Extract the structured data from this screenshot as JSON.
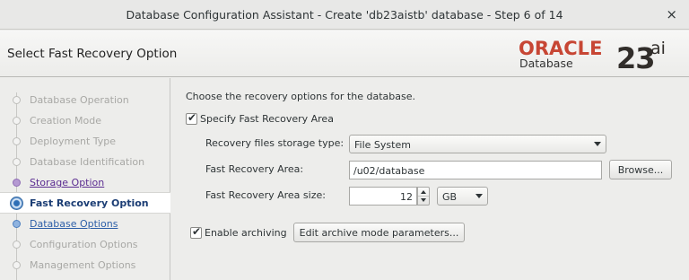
{
  "window": {
    "title": "Database Configuration Assistant - Create 'db23aistb' database - Step 6 of 14",
    "close_glyph": "×"
  },
  "header": {
    "page_title": "Select Fast Recovery Option",
    "logo": {
      "oracle": "ORACLE",
      "database": "Database",
      "version": "23",
      "suffix": "ai",
      "brand_color": "#c74634"
    }
  },
  "sidebar": {
    "steps": [
      {
        "label": "Database Operation",
        "state": "disabled"
      },
      {
        "label": "Creation Mode",
        "state": "disabled"
      },
      {
        "label": "Deployment Type",
        "state": "disabled"
      },
      {
        "label": "Database Identification",
        "state": "disabled"
      },
      {
        "label": "Storage Option",
        "state": "visited"
      },
      {
        "label": "Fast Recovery Option",
        "state": "current"
      },
      {
        "label": "Database Options",
        "state": "next"
      },
      {
        "label": "Configuration Options",
        "state": "disabled"
      },
      {
        "label": "Management Options",
        "state": "disabled"
      }
    ]
  },
  "main": {
    "intro": "Choose the recovery options for the database.",
    "specify_fra": {
      "label": "Specify Fast Recovery Area",
      "checked": true
    },
    "storage_type": {
      "label": "Recovery files storage type:",
      "value": "File System"
    },
    "fra_location": {
      "label": "Fast Recovery Area:",
      "value": "/u02/database",
      "browse_label": "Browse..."
    },
    "fra_size": {
      "label": "Fast Recovery Area size:",
      "value": "12",
      "unit": "GB"
    },
    "enable_archiving": {
      "label": "Enable archiving",
      "checked": true
    },
    "archive_params_button": "Edit archive mode parameters..."
  },
  "icons": {
    "checkbox_checked": "✔"
  }
}
